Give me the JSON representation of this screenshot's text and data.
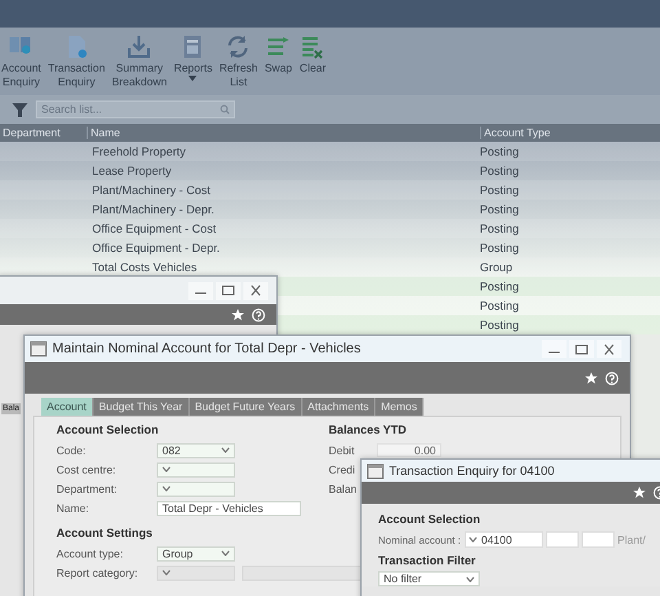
{
  "toolbar": [
    {
      "label": "Account Enquiry",
      "kind": "book",
      "menu": false
    },
    {
      "label": "Transaction Enquiry",
      "kind": "document",
      "menu": false
    },
    {
      "label": "Summary Breakdown",
      "kind": "download",
      "menu": false
    },
    {
      "label": "Reports",
      "kind": "report",
      "menu": true
    },
    {
      "label": "Refresh List",
      "kind": "refresh",
      "menu": false
    },
    {
      "label": "Swap",
      "kind": "swap",
      "menu": false
    },
    {
      "label": "Clear",
      "kind": "clear",
      "menu": false
    }
  ],
  "search": {
    "placeholder": "Search list..."
  },
  "table": {
    "columns": [
      "Department",
      "Name",
      "Account Type"
    ],
    "rows": [
      {
        "name": "Freehold Property",
        "account_type": "Posting"
      },
      {
        "name": "Lease Property",
        "account_type": "Posting"
      },
      {
        "name": "Plant/Machinery - Cost",
        "account_type": "Posting"
      },
      {
        "name": "Plant/Machinery - Depr.",
        "account_type": "Posting"
      },
      {
        "name": "Office Equipment - Cost",
        "account_type": "Posting"
      },
      {
        "name": "Office Equipment - Depr.",
        "account_type": "Posting"
      },
      {
        "name": "Total Costs Vehicles",
        "account_type": "Group"
      },
      {
        "account_type": "Posting"
      },
      {
        "account_type": "Posting"
      },
      {
        "account_type": "Posting"
      }
    ]
  },
  "background_window": {
    "tab": "Bala"
  },
  "nominal_window": {
    "title": "Maintain Nominal Account for Total Depr - Vehicles",
    "tabs": [
      {
        "label": "Account",
        "selected": true
      },
      {
        "label": "Budget This Year",
        "selected": false
      },
      {
        "label": "Budget Future Years",
        "selected": false
      },
      {
        "label": "Attachments",
        "selected": false
      },
      {
        "label": "Memos",
        "selected": false
      }
    ],
    "account_selection": {
      "heading": "Account Selection",
      "fields": [
        {
          "label": "Code:",
          "value": "082",
          "kind": "select",
          "disabled": false
        },
        {
          "label": "Cost centre:",
          "kind": "select",
          "disabled": false
        },
        {
          "label": "Department:",
          "kind": "select",
          "disabled": false
        },
        {
          "label": "Name:",
          "value": "Total Depr - Vehicles",
          "kind": "text",
          "disabled": false
        }
      ]
    },
    "account_settings": {
      "heading": "Account Settings",
      "fields": [
        {
          "label": "Account type:",
          "value": "Group",
          "kind": "select",
          "disabled": false
        },
        {
          "label": "Report category:",
          "kind": "select",
          "disabled": true,
          "extra_field": true
        }
      ]
    },
    "balances": {
      "heading": "Balances YTD",
      "fields": [
        {
          "label": "Debit",
          "value": "0.00"
        },
        {
          "label": "Credi"
        },
        {
          "label": "Balan"
        }
      ]
    }
  },
  "enquiry_window": {
    "title": "Transaction Enquiry for 04100",
    "account_selection": {
      "heading": "Account Selection",
      "label": "Nominal account :",
      "value": "04100",
      "description": "Plant/"
    },
    "filter": {
      "heading": "Transaction Filter",
      "value": "No filter"
    }
  }
}
